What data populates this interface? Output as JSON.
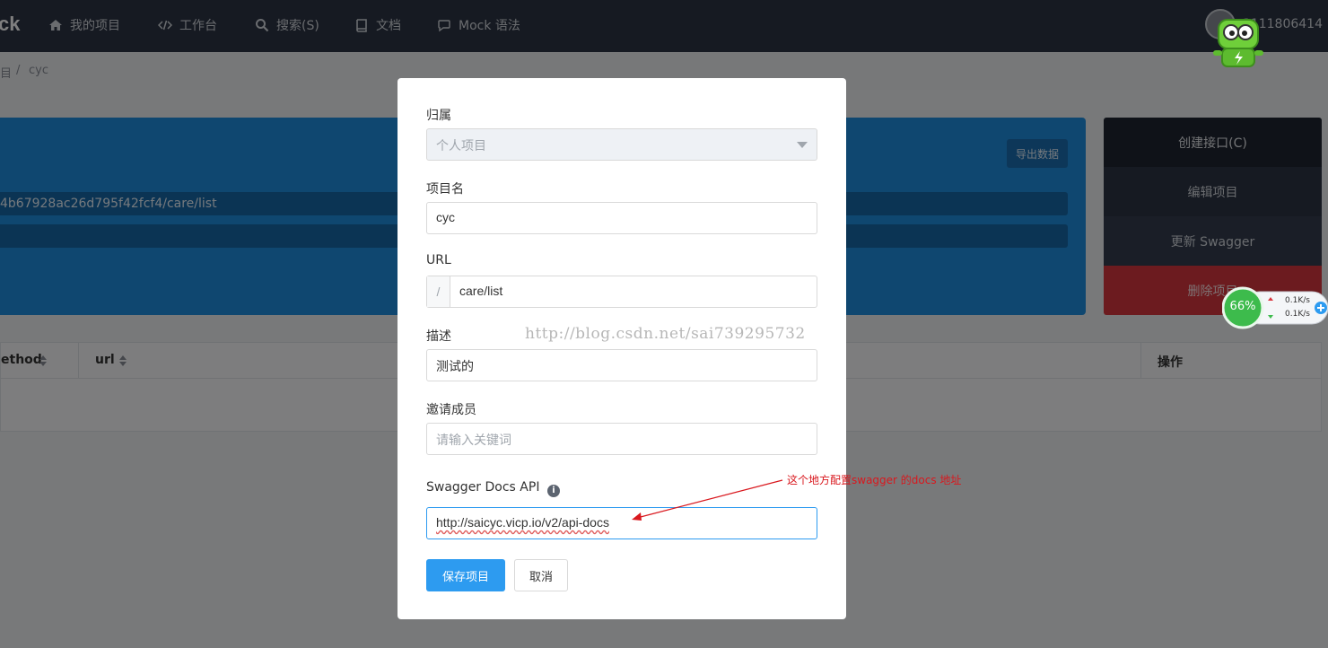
{
  "nav": {
    "brand": "ck",
    "items": [
      {
        "label": "我的项目",
        "icon": "home-icon"
      },
      {
        "label": "工作台",
        "icon": "code-icon"
      },
      {
        "label": "搜索(S)",
        "icon": "search-icon"
      },
      {
        "label": "文档",
        "icon": "book-icon"
      },
      {
        "label": "Mock 语法",
        "icon": "comment-icon"
      }
    ],
    "user": "3111806414"
  },
  "breadcrumb": {
    "parent": "目",
    "separator": "/",
    "current": "cyc"
  },
  "card": {
    "export_label": "导出数据",
    "url_line1": "4b67928ac26d795f42fcf4/care/list",
    "url_line2": ""
  },
  "side_actions": {
    "create": "创建接口(C)",
    "edit": "编辑项目",
    "swagger": "更新 Swagger",
    "delete": "删除项目"
  },
  "table": {
    "headers": [
      "ethod",
      "url",
      "操作"
    ]
  },
  "modal": {
    "owner_label": "归属",
    "owner_value": "个人项目",
    "name_label": "项目名",
    "name_value": "cyc",
    "url_label": "URL",
    "url_prefix": "/",
    "url_value": "care/list",
    "desc_label": "描述",
    "desc_value": "测试的",
    "members_label": "邀请成员",
    "members_placeholder": "请输入关键词",
    "swagger_label": "Swagger Docs API",
    "swagger_value": "http://saicyc.vicp.io/v2/api-docs",
    "save_label": "保存项目",
    "cancel_label": "取消"
  },
  "watermark": "http://blog.csdn.net/sai739295732",
  "annotation": "这个地方配置swagger 的docs 地址",
  "speed_widget": {
    "percent": "66%",
    "up": "0.1K/s",
    "down": "0.1K/s"
  },
  "colors": {
    "accent": "#2d9bf0",
    "nav_bg": "#2d3545",
    "card_blue": "#1e8fe0",
    "danger": "#d9363e",
    "annotation": "#d9181e"
  }
}
